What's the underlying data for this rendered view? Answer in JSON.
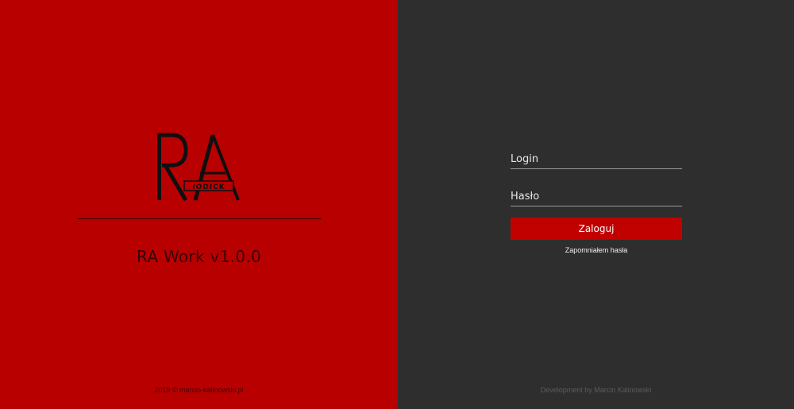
{
  "left": {
    "logo": {
      "letters": "RA",
      "badge": "IODICK"
    },
    "title": "RA Work v1.0.0",
    "footer": "2019 © marcin-kalinowski.pl"
  },
  "form": {
    "login_placeholder": "Login",
    "password_placeholder": "Hasło",
    "submit_label": "Zaloguj",
    "forgot_label": "Zapomniałem hasła"
  },
  "right": {
    "footer": "Development by Marcin Kalinowski"
  },
  "colors": {
    "left_background": "#b90000",
    "right_background": "#2e2e2e",
    "button_background": "#c10000"
  }
}
